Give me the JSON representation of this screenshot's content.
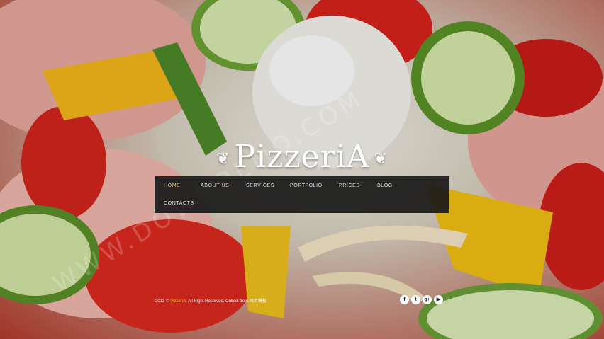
{
  "logo": {
    "text": "PizzeriA"
  },
  "nav": {
    "items": [
      {
        "label": "HOME",
        "active": true
      },
      {
        "label": "ABOUT US"
      },
      {
        "label": "SERVICES"
      },
      {
        "label": "PORTFOLIO"
      },
      {
        "label": "PRICES"
      },
      {
        "label": "BLOG"
      },
      {
        "label": "CONTACTS"
      }
    ]
  },
  "footer": {
    "year": "2012 ©",
    "brand": "PizzeriA",
    "rights": ". All Right Reserved. Collect from",
    "link": "网页模板"
  },
  "social": [
    {
      "name": "facebook-icon",
      "glyph": "f"
    },
    {
      "name": "twitter-icon",
      "glyph": "t"
    },
    {
      "name": "google-plus-icon",
      "glyph": "g+"
    },
    {
      "name": "youtube-icon",
      "glyph": "▶"
    }
  ],
  "watermark": "WWW.DOWNDEMO.COM",
  "colors": {
    "accent": "#f4c21a",
    "nav_bg": "#191919",
    "text": "#ffffff"
  }
}
